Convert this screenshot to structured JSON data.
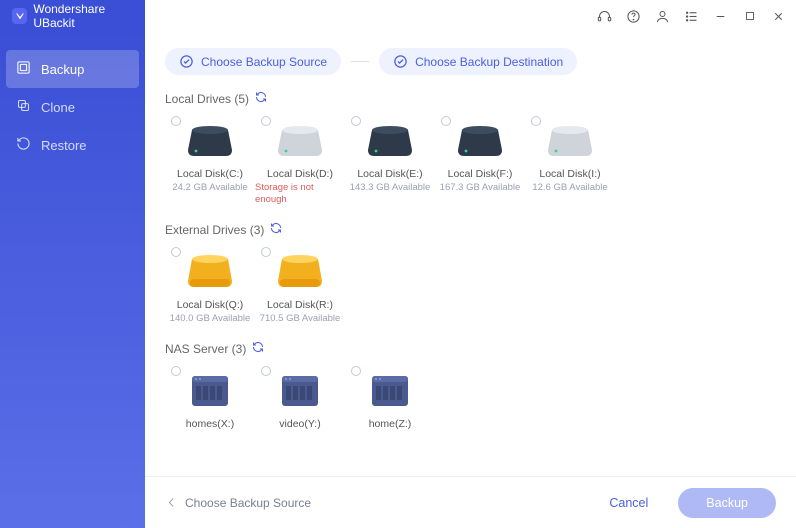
{
  "app": {
    "title": "Wondershare UBackit"
  },
  "sidebar": {
    "items": [
      {
        "label": "Backup",
        "active": true
      },
      {
        "label": "Clone",
        "active": false
      },
      {
        "label": "Restore",
        "active": false
      }
    ]
  },
  "steps": [
    {
      "label": "Choose Backup Source"
    },
    {
      "label": "Choose Backup Destination"
    }
  ],
  "sections": [
    {
      "title": "Local Drives",
      "count": 5,
      "kind": "internal",
      "drives": [
        {
          "name": "Local Disk(C:)",
          "sub": "24.2 GB Available",
          "warn": false,
          "color": "dark"
        },
        {
          "name": "Local Disk(D:)",
          "sub": "Storage is not enough",
          "warn": true,
          "color": "light"
        },
        {
          "name": "Local Disk(E:)",
          "sub": "143.3 GB Available",
          "warn": false,
          "color": "dark"
        },
        {
          "name": "Local Disk(F:)",
          "sub": "167.3 GB Available",
          "warn": false,
          "color": "dark"
        },
        {
          "name": "Local Disk(I:)",
          "sub": "12.6 GB Available",
          "warn": false,
          "color": "light"
        }
      ]
    },
    {
      "title": "External Drives",
      "count": 3,
      "kind": "external",
      "drives": [
        {
          "name": "Local Disk(Q:)",
          "sub": "140.0 GB Available",
          "warn": false
        },
        {
          "name": "Local Disk(R:)",
          "sub": "710.5 GB Available",
          "warn": false
        }
      ]
    },
    {
      "title": "NAS Server",
      "count": 3,
      "kind": "nas",
      "drives": [
        {
          "name": "homes(X:)",
          "sub": "",
          "warn": false
        },
        {
          "name": "video(Y:)",
          "sub": "",
          "warn": false
        },
        {
          "name": "home(Z:)",
          "sub": "",
          "warn": false
        }
      ]
    }
  ],
  "footer": {
    "hint": "Choose Backup Source",
    "cancel": "Cancel",
    "primary": "Backup"
  }
}
